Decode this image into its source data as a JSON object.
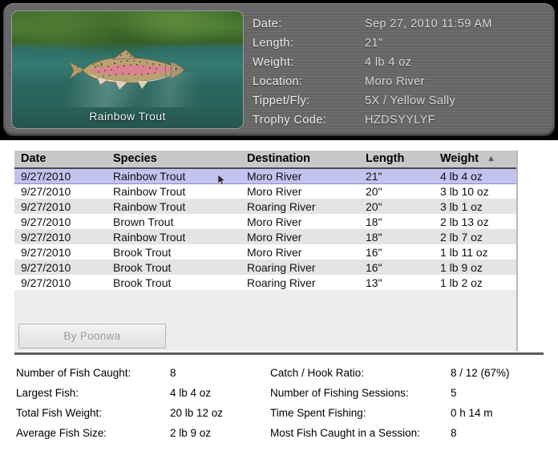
{
  "detail_panel": {
    "photo": {
      "caption": "Rainbow Trout",
      "species_icon": "rainbow-trout-icon",
      "water_color": "#2e6f68",
      "foliage_color": "#4a7a32"
    },
    "fields": [
      {
        "label": "Date:",
        "value": "Sep 27, 2010  11:59 AM"
      },
      {
        "label": "Length:",
        "value": "21\""
      },
      {
        "label": "Weight:",
        "value": "4 lb 4 oz"
      },
      {
        "label": "Location:",
        "value": "Moro River"
      },
      {
        "label": "Tippet/Fly:",
        "value": "5X / Yellow Sally"
      },
      {
        "label": "Trophy Code:",
        "value": "HZDSYYLYF"
      }
    ]
  },
  "catch_table": {
    "columns": [
      {
        "key": "date",
        "label": "Date",
        "sorted": false
      },
      {
        "key": "species",
        "label": "Species",
        "sorted": false
      },
      {
        "key": "destination",
        "label": "Destination",
        "sorted": false
      },
      {
        "key": "length",
        "label": "Length",
        "sorted": false
      },
      {
        "key": "weight",
        "label": "Weight",
        "sorted": true,
        "sort_direction": "ascending",
        "sort_glyph": "▲"
      }
    ],
    "selected_row_index": 0,
    "selected_row_color": "#c3c3f0",
    "rows": [
      {
        "date": "9/27/2010",
        "species": "Rainbow Trout",
        "destination": "Moro River",
        "length": "21\"",
        "weight": "4 lb 4 oz"
      },
      {
        "date": "9/27/2010",
        "species": "Rainbow Trout",
        "destination": "Moro River",
        "length": "20\"",
        "weight": "3 lb 10 oz"
      },
      {
        "date": "9/27/2010",
        "species": "Rainbow Trout",
        "destination": "Roaring River",
        "length": "20\"",
        "weight": "3 lb 1 oz"
      },
      {
        "date": "9/27/2010",
        "species": "Brown Trout",
        "destination": "Moro River",
        "length": "18\"",
        "weight": "2 lb 13 oz"
      },
      {
        "date": "9/27/2010",
        "species": "Rainbow Trout",
        "destination": "Moro River",
        "length": "18\"",
        "weight": "2 lb 7 oz"
      },
      {
        "date": "9/27/2010",
        "species": "Brook Trout",
        "destination": "Moro River",
        "length": "16\"",
        "weight": "1 lb 11 oz"
      },
      {
        "date": "9/27/2010",
        "species": "Brook Trout",
        "destination": "Roaring River",
        "length": "16\"",
        "weight": "1 lb 9 oz"
      },
      {
        "date": "9/27/2010",
        "species": "Brook Trout",
        "destination": "Roaring River",
        "length": "13\"",
        "weight": "1 lb 2 oz"
      }
    ]
  },
  "toolbar": {
    "poonwa_button_label": "By Poonwa",
    "poonwa_button_enabled": false
  },
  "statistics": {
    "left": [
      {
        "label": "Number of Fish Caught:",
        "value": "8"
      },
      {
        "label": "Largest Fish:",
        "value": "4 lb 4 oz"
      },
      {
        "label": "Total Fish Weight:",
        "value": "20 lb 12 oz"
      },
      {
        "label": "Average Fish Size:",
        "value": "2 lb 9 oz"
      }
    ],
    "right": [
      {
        "label": "Catch / Hook Ratio:",
        "value": "8 / 12 (67%)"
      },
      {
        "label": "Number of Fishing Sessions:",
        "value": "5"
      },
      {
        "label": "Time Spent Fishing:",
        "value": "0 h 14 m"
      },
      {
        "label": "Most Fish Caught in a Session:",
        "value": "8"
      }
    ]
  }
}
